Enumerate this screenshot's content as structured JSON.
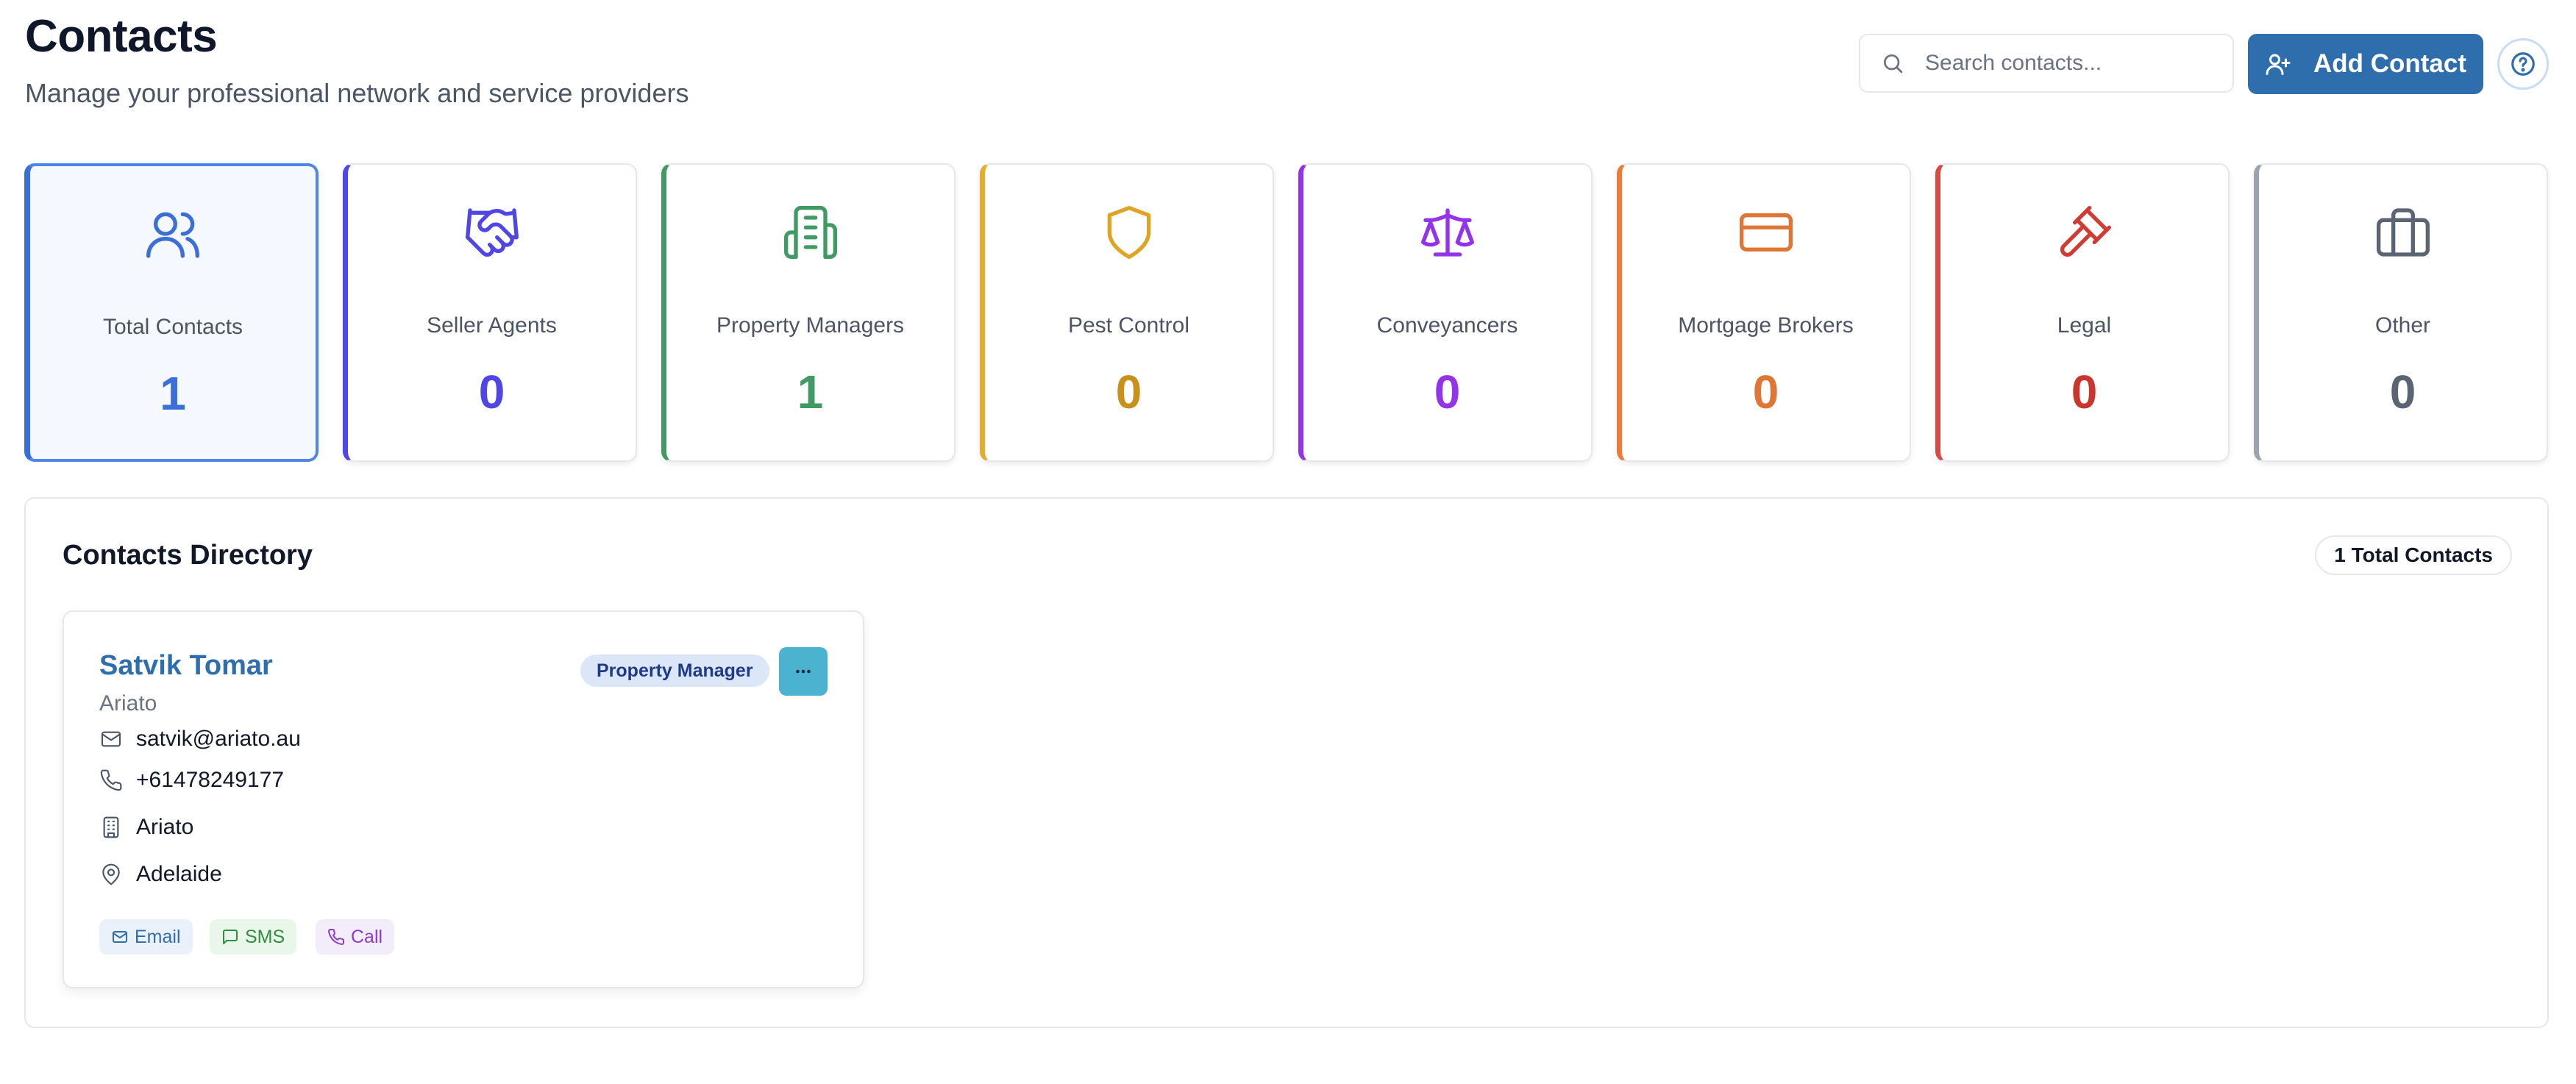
{
  "header": {
    "title": "Contacts",
    "subtitle": "Manage your professional network and service providers",
    "search_placeholder": "Search contacts...",
    "add_button_label": "Add Contact"
  },
  "stats": [
    {
      "label": "Total Contacts",
      "count": "1",
      "icon": "users-icon",
      "color": "#3b6fd8"
    },
    {
      "label": "Seller Agents",
      "count": "0",
      "icon": "handshake-icon",
      "color": "#4f46e5"
    },
    {
      "label": "Property Managers",
      "count": "1",
      "icon": "building-icon",
      "color": "#3f9a63"
    },
    {
      "label": "Pest Control",
      "count": "0",
      "icon": "shield-icon",
      "color": "#d09a16"
    },
    {
      "label": "Conveyancers",
      "count": "0",
      "icon": "scale-icon",
      "color": "#9333ea"
    },
    {
      "label": "Mortgage Brokers",
      "count": "0",
      "icon": "credit-card-icon",
      "color": "#e07636"
    },
    {
      "label": "Legal",
      "count": "0",
      "icon": "gavel-icon",
      "color": "#c9362e"
    },
    {
      "label": "Other",
      "count": "0",
      "icon": "briefcase-icon",
      "color": "#5b6472"
    }
  ],
  "directory": {
    "title": "Contacts Directory",
    "total_badge": "1 Total Contacts",
    "contacts": [
      {
        "name": "Satvik Tomar",
        "company": "Ariato",
        "category": "Property Manager",
        "email": "satvik@ariato.au",
        "phone": "+61478249177",
        "organization": "Ariato",
        "location": "Adelaide",
        "actions": {
          "email": "Email",
          "sms": "SMS",
          "call": "Call"
        }
      }
    ]
  }
}
